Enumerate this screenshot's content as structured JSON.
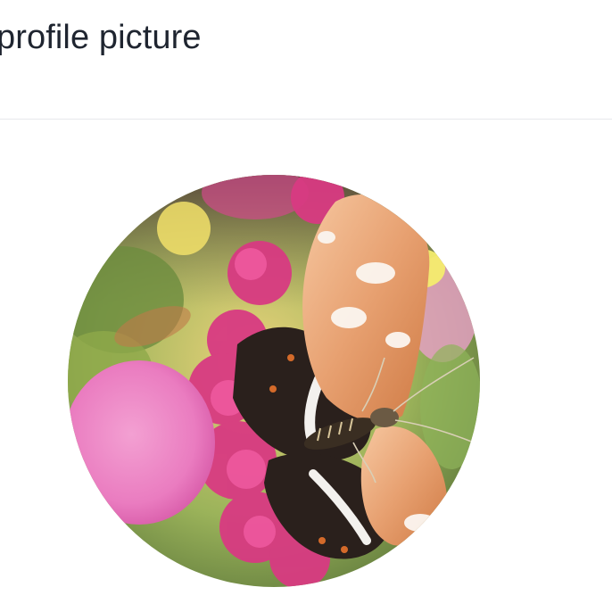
{
  "header": {
    "title": "profile picture"
  },
  "avatar": {
    "subject": "butterfly-on-pink-flowers-photo"
  },
  "colors": {
    "title_text": "#1f2530",
    "divider": "#e6e8ec",
    "background": "#ffffff"
  }
}
